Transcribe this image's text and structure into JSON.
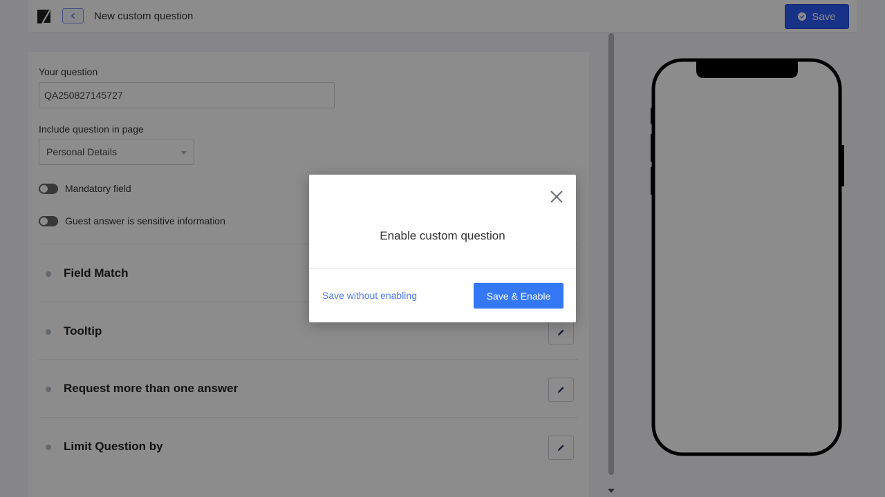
{
  "header": {
    "title": "New custom question",
    "save_label": "Save",
    "logo_icon": "brand-logo-icon",
    "back_icon": "chevron-left-icon"
  },
  "form": {
    "question_label": "Your question",
    "question_value": "QA250827145727",
    "page_label": "Include question in page",
    "page_value": "Personal Details",
    "mandatory_label": "Mandatory field",
    "sensitive_label": "Guest answer is sensitive information"
  },
  "sections": [
    {
      "title": "Field Match"
    },
    {
      "title": "Tooltip"
    },
    {
      "title": "Request more than one answer"
    },
    {
      "title": "Limit Question by"
    }
  ],
  "modal": {
    "title": "Enable custom question",
    "secondary_label": "Save without enabling",
    "primary_label": "Save & Enable"
  },
  "colors": {
    "accent": "#2d5cf6",
    "primary_button": "#3478f6",
    "link": "#4f7cf0"
  }
}
